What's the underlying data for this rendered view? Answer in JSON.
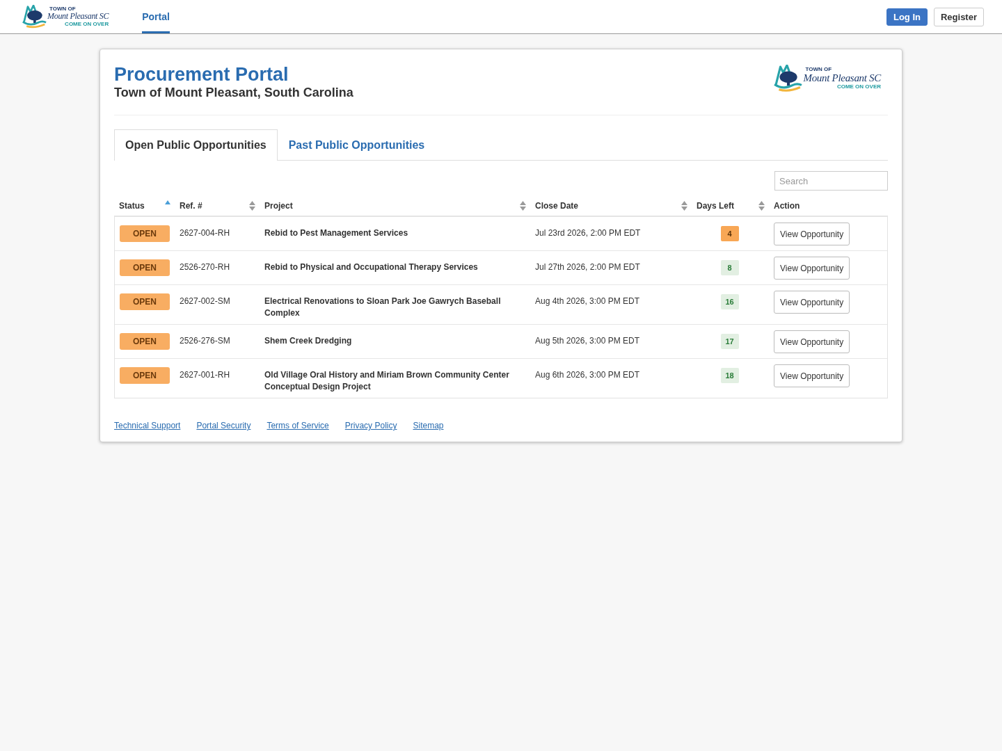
{
  "top_bar": {
    "logo": {
      "top_line": "TOWN OF",
      "name": "Mount Pleasant SC",
      "tagline": "COME ON OVER"
    },
    "nav": [
      {
        "label": "Portal",
        "selected": true
      }
    ],
    "buttons": [
      {
        "label": "Log In",
        "kind": "primary"
      },
      {
        "label": "Register",
        "kind": "default"
      }
    ]
  },
  "card": {
    "title": "Procurement Portal",
    "subtitle": "Town of Mount Pleasant, South Carolina",
    "logo": {
      "top_line": "TOWN OF",
      "name": "Mount Pleasant SC",
      "tagline": "COME ON OVER"
    },
    "tabs": [
      {
        "label": "Open Public Opportunities",
        "selected": true
      },
      {
        "label": "Past Public Opportunities",
        "selected": false
      }
    ],
    "search": {
      "placeholder": "Search"
    },
    "table": {
      "columns": [
        {
          "label": "Status",
          "sortable": true,
          "sorted": true
        },
        {
          "label": "Ref. #",
          "sortable": true,
          "sorted": false
        },
        {
          "label": "Project",
          "sortable": true,
          "sorted": false
        },
        {
          "label": "Close Date",
          "sortable": true,
          "sorted": false
        },
        {
          "label": "Days Left",
          "sortable": true,
          "sorted": false
        },
        {
          "label": "Action",
          "sortable": false,
          "sorted": false
        }
      ],
      "rows": [
        {
          "status": "OPEN",
          "ref": "2627-004-RH",
          "project": "Rebid to Pest Management Services",
          "close_date": "Jul 23rd 2026, 2:00 PM EDT",
          "days_left": "4",
          "urgent": true,
          "action": "View Opportunity"
        },
        {
          "status": "OPEN",
          "ref": "2526-270-RH",
          "project": "Rebid to Physical and Occupational Therapy Services",
          "close_date": "Jul 27th 2026, 2:00 PM EDT",
          "days_left": "8",
          "urgent": false,
          "action": "View Opportunity"
        },
        {
          "status": "OPEN",
          "ref": "2627-002-SM",
          "project": "Electrical Renovations to Sloan Park Joe Gawrych Baseball Complex",
          "close_date": "Aug 4th 2026, 3:00 PM EDT",
          "days_left": "16",
          "urgent": false,
          "action": "View Opportunity"
        },
        {
          "status": "OPEN",
          "ref": "2526-276-SM",
          "project": "Shem Creek Dredging",
          "close_date": "Aug 5th 2026, 3:00 PM EDT",
          "days_left": "17",
          "urgent": false,
          "action": "View Opportunity"
        },
        {
          "status": "OPEN",
          "ref": "2627-001-RH",
          "project": "Old Village Oral History and Miriam Brown Community Center Conceptual Design Project",
          "close_date": "Aug 6th 2026, 3:00 PM EDT",
          "days_left": "18",
          "urgent": false,
          "action": "View Opportunity"
        }
      ]
    },
    "footer_links": [
      "Technical Support",
      "Portal Security",
      "Terms of Service",
      "Privacy Policy",
      "Sitemap"
    ]
  }
}
